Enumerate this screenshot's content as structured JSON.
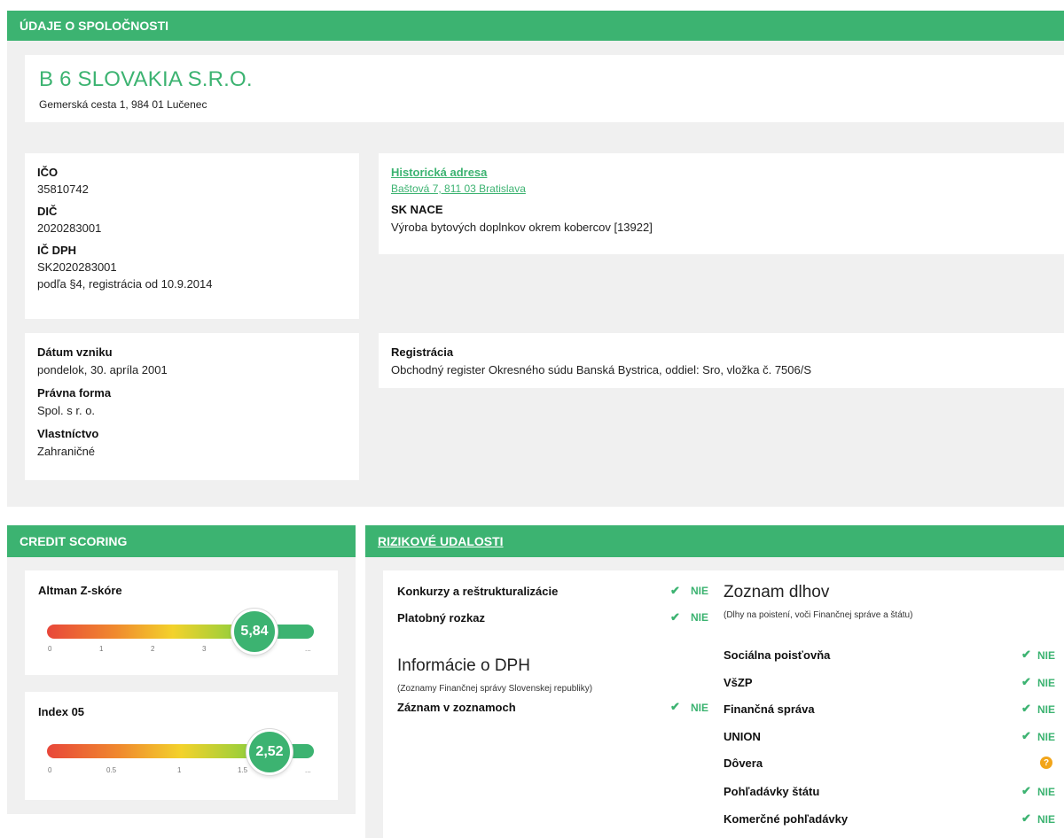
{
  "header": {
    "title": "ÚDAJE O SPOLOČNOSTI"
  },
  "company": {
    "name": "B 6 SLOVAKIA S.R.O.",
    "address": "Gemerská cesta 1, 984 01 Lučenec"
  },
  "ids": {
    "ico_label": "IČO",
    "ico_value": "35810742",
    "dic_label": "DIČ",
    "dic_value": "2020283001",
    "icdph_label": "IČ DPH",
    "icdph_value": "SK2020283001",
    "icdph_note": "podľa §4, registrácia od 10.9.2014"
  },
  "history": {
    "link_label": "Historická adresa",
    "link_address": "Baštová 7, 811 03 Bratislava",
    "nace_label": "SK NACE",
    "nace_value": "Výroba bytových doplnkov okrem kobercov [13922]"
  },
  "founding": {
    "date_label": "Dátum vzniku",
    "date_value": "pondelok, 30. apríla 2001",
    "form_label": "Právna forma",
    "form_value": "Spol. s r. o.",
    "ownership_label": "Vlastníctvo",
    "ownership_value": "Zahraničné"
  },
  "registration": {
    "label": "Registrácia",
    "value": "Obchodný register Okresného súdu Banská Bystrica, oddiel: Sro, vložka č. 7506/S"
  },
  "credit": {
    "title": "CREDIT SCORING",
    "altman": {
      "label": "Altman Z-skóre",
      "value": "5,84",
      "ticks": [
        "0",
        "1",
        "2",
        "3",
        "..."
      ]
    },
    "index05": {
      "label": "Index 05",
      "value": "2,52",
      "ticks": [
        "0",
        "0.5",
        "1",
        "1.5",
        "..."
      ]
    }
  },
  "risk": {
    "title": "RIZIKOVÉ UDALOSTI",
    "status_no": "NIE",
    "events": [
      {
        "label": "Konkurzy a reštrukturalizácie",
        "status": "NIE"
      },
      {
        "label": "Platobný rozkaz",
        "status": "NIE"
      }
    ],
    "vat": {
      "title": "Informácie o DPH",
      "subtitle": "(Zoznamy Finančnej správy Slovenskej republiky)",
      "record_label": "Záznam v zoznamoch",
      "record_status": "NIE"
    },
    "debts": {
      "title": "Zoznam dlhov",
      "subtitle": "(Dlhy na poistení, voči Finančnej správe a štátu)",
      "items": [
        {
          "label": "Sociálna poisťovňa",
          "status": "NIE"
        },
        {
          "label": "VšZP",
          "status": "NIE"
        },
        {
          "label": "Finančná správa",
          "status": "NIE"
        },
        {
          "label": "UNION",
          "status": "NIE"
        },
        {
          "label": "Dôvera",
          "status": "?"
        },
        {
          "label": "Pohľadávky štátu",
          "status": "NIE"
        },
        {
          "label": "Komerčné pohľadávky",
          "status": "NIE"
        }
      ]
    }
  },
  "colors": {
    "accent": "#3cb371",
    "panel": "#f0f0f0",
    "warning": "#f2a51a"
  }
}
